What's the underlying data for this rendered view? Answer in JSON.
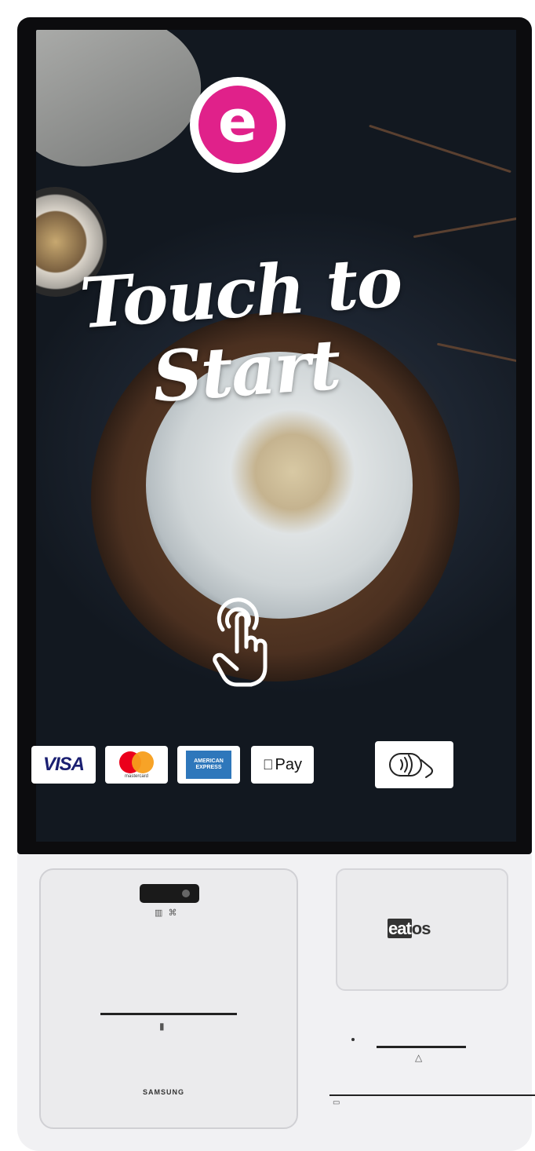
{
  "screen": {
    "logo_letter": "e",
    "title_line1": "Touch to",
    "title_line2": "Start"
  },
  "payments": {
    "visa": "VISA",
    "mastercard": "mastercard",
    "amex": "AMERICAN EXPRESS",
    "apple_pay": "Pay"
  },
  "device": {
    "scanner_label": "▥ ⌘",
    "brand": "SAMSUNG",
    "vendor_prefix": "eat",
    "vendor_suffix": "os"
  },
  "colors": {
    "accent": "#e0218a",
    "visa_blue": "#1a1f71",
    "amex_blue": "#2e77bb",
    "mc_red": "#eb001b",
    "mc_orange": "#f79e1b"
  },
  "icons": [
    "touch-hand-icon",
    "contactless-icon",
    "apple-icon",
    "card-slot-icon",
    "receipt-icon"
  ]
}
